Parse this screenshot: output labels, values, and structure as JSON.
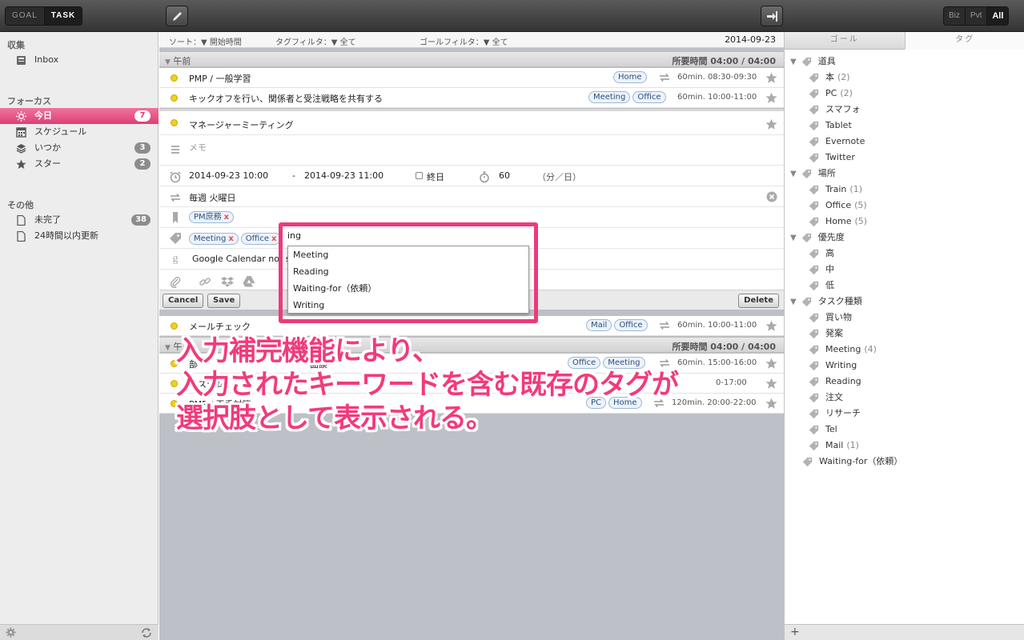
{
  "topbar": {
    "goal_label": "GOAL",
    "task_label": "TASK",
    "scope": [
      "Biz",
      "Pvt",
      "All"
    ]
  },
  "sidebar": {
    "sections": [
      {
        "title": "収集",
        "items": [
          {
            "label": "Inbox",
            "icon": "inbox-icon"
          }
        ]
      },
      {
        "title": "フォーカス",
        "items": [
          {
            "label": "今日",
            "count": "7",
            "icon": "sun-icon"
          },
          {
            "label": "スケジュール",
            "icon": "calendar-icon"
          },
          {
            "label": "いつか",
            "count": "3",
            "icon": "layers-icon"
          },
          {
            "label": "スター",
            "count": "2",
            "icon": "star-icon"
          }
        ]
      },
      {
        "title": "その他",
        "items": [
          {
            "label": "未完了",
            "count": "38",
            "icon": "document-icon"
          },
          {
            "label": "24時間以内更新",
            "icon": "document-icon"
          }
        ]
      }
    ]
  },
  "main": {
    "sort_label": "ソート：▼ 開始時間",
    "tag_filter_label": "タグフィルタ：▼ 全て",
    "goal_filter_label": "ゴールフィルタ：▼ 全て",
    "date": "2014-09-23",
    "group_am": {
      "title": "午前",
      "time": "所要時間 04:00 / 04:00"
    },
    "group_pm": {
      "title": "午",
      "time": "所要時間 04:00 / 04:00"
    },
    "tasks_am": [
      {
        "title": "PMP / 一般学習",
        "tags": [
          "Home"
        ],
        "duration": "60min. 08:30-09:30"
      },
      {
        "title": "キックオフを行い、関係者と受注戦略を共有する",
        "tags": [
          "Meeting",
          "Office"
        ],
        "duration": "60min. 10:00-11:00"
      }
    ],
    "editor": {
      "title": "マネージャーミーティング",
      "memo_placeholder": "メモ",
      "start": "2014-09-23  10:00",
      "dash": "-",
      "end": "2014-09-23  11:00",
      "allday": "終日",
      "minutes": "60",
      "unit": "（分／日）",
      "repeat": "毎週 火曜日",
      "goal_tag": "PM庶務",
      "tags": [
        "Meeting",
        "Office"
      ],
      "tag_input": "ing",
      "gcal": "Google Calendar not s",
      "cancel": "Cancel",
      "save": "Save",
      "delete": "Delete"
    },
    "autocomplete": [
      "Meeting",
      "Reading",
      "Waiting-for（依頼）",
      "Writing"
    ],
    "task_mail": {
      "title": "メールチェック",
      "tags": [
        "Mail",
        "Office"
      ],
      "duration": "60min. 10:00-11:00"
    },
    "tasks_pm": [
      {
        "title": "部",
        "tail": "面談",
        "tags": [
          "Office",
          "Meeting"
        ],
        "duration": "60min. 15:00-16:00"
      },
      {
        "title": "システム",
        "tail": "る",
        "tags": [],
        "duration": "0-17:00"
      },
      {
        "title": "PMP / 王手対策",
        "tail": "",
        "tags": [
          "PC",
          "Home"
        ],
        "duration": "120min. 20:00-22:00"
      }
    ]
  },
  "right": {
    "tabs": [
      "ゴール",
      "タグ"
    ],
    "tree": [
      {
        "label": "道具",
        "level": 0,
        "folder": true
      },
      {
        "label": "本",
        "count": "(2)",
        "level": 1
      },
      {
        "label": "PC",
        "count": "(2)",
        "level": 1
      },
      {
        "label": "スマフォ",
        "level": 1
      },
      {
        "label": "Tablet",
        "level": 1
      },
      {
        "label": "Evernote",
        "level": 1
      },
      {
        "label": "Twitter",
        "level": 1
      },
      {
        "label": "場所",
        "level": 0,
        "folder": true
      },
      {
        "label": "Train",
        "count": "(1)",
        "level": 1
      },
      {
        "label": "Office",
        "count": "(5)",
        "level": 1
      },
      {
        "label": "Home",
        "count": "(5)",
        "level": 1
      },
      {
        "label": "優先度",
        "level": 0,
        "folder": true
      },
      {
        "label": "高",
        "level": 1
      },
      {
        "label": "中",
        "level": 1
      },
      {
        "label": "低",
        "level": 1
      },
      {
        "label": "タスク種類",
        "level": 0,
        "folder": true
      },
      {
        "label": "買い物",
        "level": 1
      },
      {
        "label": "発案",
        "level": 1
      },
      {
        "label": "Meeting",
        "count": "(4)",
        "level": 1
      },
      {
        "label": "Writing",
        "level": 1
      },
      {
        "label": "Reading",
        "level": 1
      },
      {
        "label": "注文",
        "level": 1
      },
      {
        "label": "リサーチ",
        "level": 1
      },
      {
        "label": "Tel",
        "level": 1
      },
      {
        "label": "Mail",
        "count": "(1)",
        "level": 1
      },
      {
        "label": "Waiting-for（依頼）",
        "level": 0
      }
    ],
    "add": "+"
  },
  "annotation": {
    "line1": "入力補完機能により、",
    "line2": "入力されたキーワードを含む既存のタグが",
    "line3": "選択肢として表示される。"
  },
  "colors": {
    "accent": "#de3f76",
    "callout": "#ec3a7c",
    "tag_border": "#9bb6d6"
  }
}
